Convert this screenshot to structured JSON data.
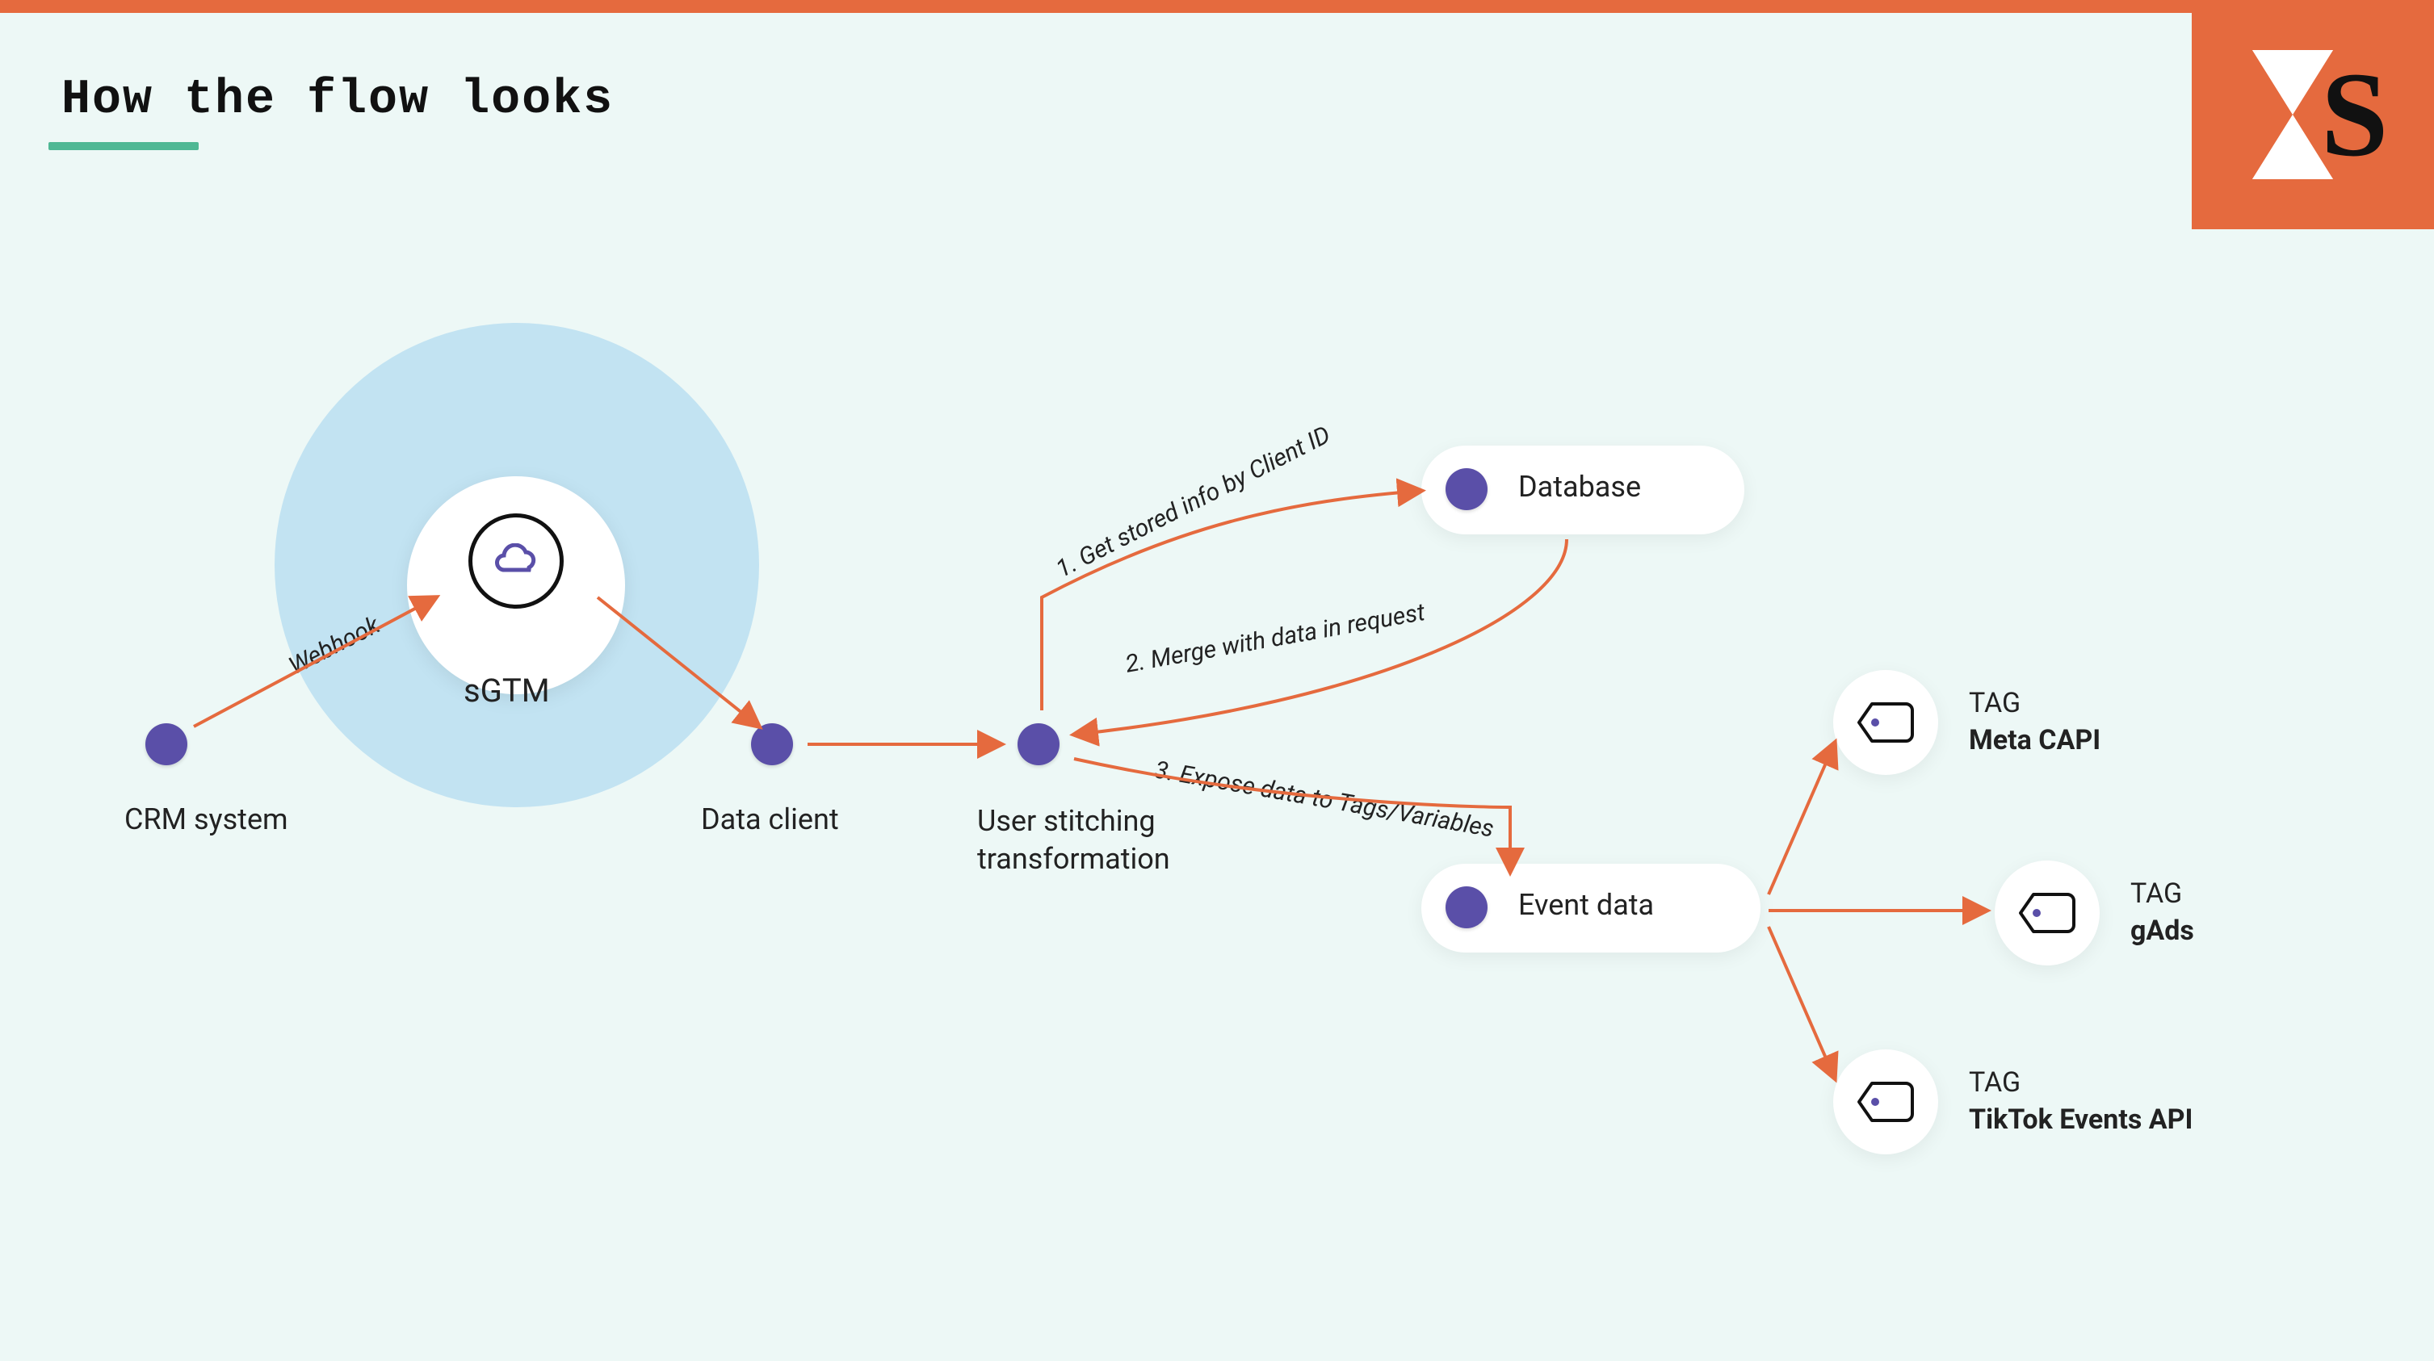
{
  "title": "How the flow looks",
  "logo_letter": "S",
  "colors": {
    "accent_orange": "#e56a3e",
    "bg": "#edf8f6",
    "halo": "#c2e3f2",
    "node": "#5a4fa8",
    "underline": "#4fb894"
  },
  "nodes": {
    "crm": {
      "label": "CRM system"
    },
    "sgtm": {
      "label": "sGTM"
    },
    "data_client": {
      "label": "Data client"
    },
    "stitch": {
      "label_line1": "User stitching",
      "label_line2": "transformation"
    },
    "database": {
      "label": "Database"
    },
    "event": {
      "label": "Event data"
    }
  },
  "tags": {
    "meta": {
      "top": "TAG",
      "bottom": "Meta CAPI"
    },
    "gads": {
      "top": "TAG",
      "bottom": "gAds"
    },
    "tiktok": {
      "top": "TAG",
      "bottom": "TikTok Events API"
    }
  },
  "edges": {
    "webhook": "Webhook",
    "step1": "1. Get stored info by Client ID",
    "step2": "2. Merge with data in request",
    "step3": "3. Expose data to Tags/Variables"
  }
}
